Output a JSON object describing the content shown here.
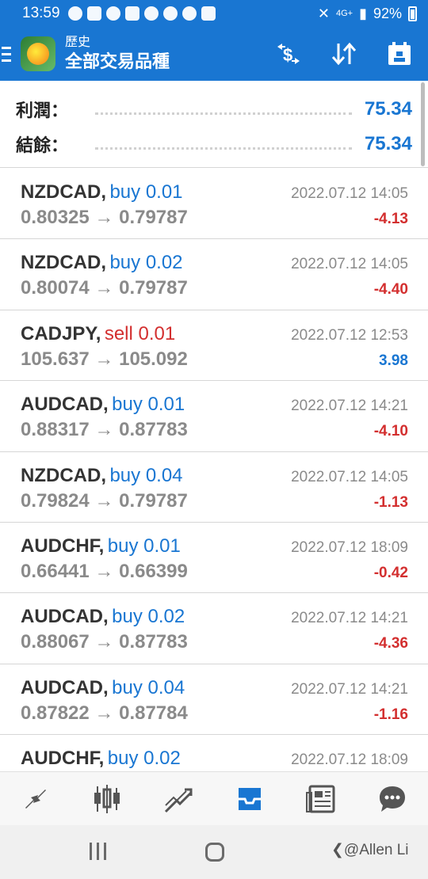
{
  "status_bar": {
    "time": "13:59",
    "signal_text": "4G+",
    "battery": "92%"
  },
  "app_bar": {
    "subtitle": "歷史",
    "title": "全部交易品種",
    "icons": [
      "menu-icon",
      "app-logo",
      "currency-icon",
      "sort-icon",
      "calendar-icon"
    ]
  },
  "summary": {
    "profit_label": "利潤：",
    "profit_value": "75.34",
    "balance_label": "結餘：",
    "balance_value": "75.34"
  },
  "trades": [
    {
      "symbol": "NZDCAD,",
      "side": "buy 0.01",
      "type": "buy",
      "date": "2022.07.12 14:05",
      "prices": "0.80325 → 0.79787",
      "profit": "-4.13",
      "sign": "neg"
    },
    {
      "symbol": "NZDCAD,",
      "side": "buy 0.02",
      "type": "buy",
      "date": "2022.07.12 14:05",
      "prices": "0.80074 → 0.79787",
      "profit": "-4.40",
      "sign": "neg"
    },
    {
      "symbol": "CADJPY,",
      "side": "sell 0.01",
      "type": "sell",
      "date": "2022.07.12 12:53",
      "prices": "105.637 → 105.092",
      "profit": "3.98",
      "sign": "pos"
    },
    {
      "symbol": "AUDCAD,",
      "side": "buy 0.01",
      "type": "buy",
      "date": "2022.07.12 14:21",
      "prices": "0.88317 → 0.87783",
      "profit": "-4.10",
      "sign": "neg"
    },
    {
      "symbol": "NZDCAD,",
      "side": "buy 0.04",
      "type": "buy",
      "date": "2022.07.12 14:05",
      "prices": "0.79824 → 0.79787",
      "profit": "-1.13",
      "sign": "neg"
    },
    {
      "symbol": "AUDCHF,",
      "side": "buy 0.01",
      "type": "buy",
      "date": "2022.07.12 18:09",
      "prices": "0.66441 → 0.66399",
      "profit": "-0.42",
      "sign": "neg"
    },
    {
      "symbol": "AUDCAD,",
      "side": "buy 0.02",
      "type": "buy",
      "date": "2022.07.12 14:21",
      "prices": "0.88067 → 0.87783",
      "profit": "-4.36",
      "sign": "neg"
    },
    {
      "symbol": "AUDCAD,",
      "side": "buy 0.04",
      "type": "buy",
      "date": "2022.07.12 14:21",
      "prices": "0.87822 → 0.87784",
      "profit": "-1.16",
      "sign": "neg"
    },
    {
      "symbol": "AUDCHF,",
      "side": "buy 0.02",
      "type": "buy",
      "date": "2022.07.12 18:09",
      "prices": "",
      "profit": "",
      "sign": "neg"
    }
  ],
  "tabs": [
    {
      "icon": "quotes-icon",
      "active": false
    },
    {
      "icon": "chart-icon",
      "active": false
    },
    {
      "icon": "trade-icon",
      "active": false
    },
    {
      "icon": "history-icon",
      "active": true
    },
    {
      "icon": "news-icon",
      "active": false
    },
    {
      "icon": "chat-icon",
      "active": false
    }
  ],
  "colors": {
    "accent": "#1976d2",
    "negative": "#d32f2f",
    "inactive_icon": "#555555"
  },
  "watermark": "@Allen Li"
}
